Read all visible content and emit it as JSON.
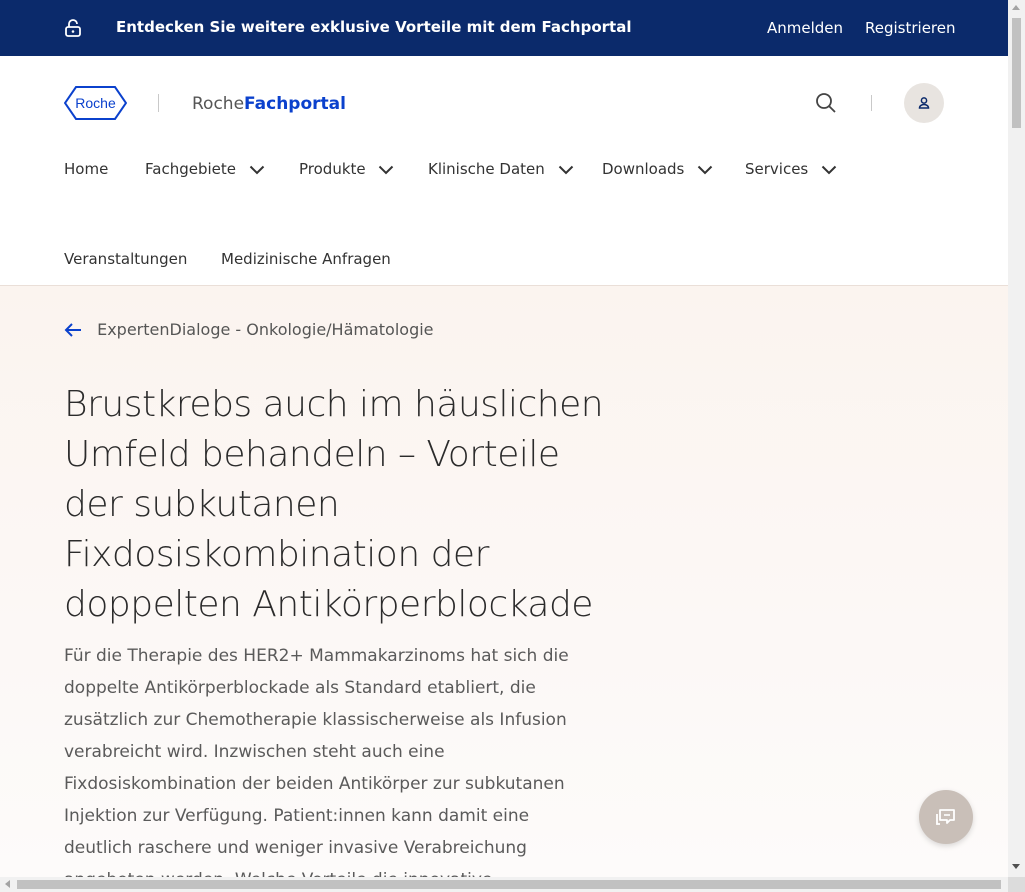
{
  "topbar": {
    "promo": "Entdecken Sie weitere exklusive Vorteile mit dem Fachportal",
    "login": "Anmelden",
    "register": "Registrieren",
    "icon": "lock-open-icon",
    "background": "#0b2a6b"
  },
  "header": {
    "logo_text": "Roche",
    "portal_prefix": "Roche",
    "portal_suffix": "Fachportal",
    "accent": "#0b41cd"
  },
  "nav": {
    "home": "Home",
    "fachgebiete": "Fachgebiete",
    "produkte": "Produkte",
    "klinische": "Klinische Daten",
    "downloads": "Downloads",
    "services": "Services",
    "veranstaltungen": "Veranstaltungen",
    "anfragen": "Medizinische Anfragen"
  },
  "hero": {
    "breadcrumb": "ExpertenDialoge - Onkologie/Hämatologie",
    "title": "Brustkrebs auch im häuslichen Umfeld behandeln – Vorteile der subkutanen Fixdosiskombination der doppelten Antikörperblockade",
    "intro": "Für die Therapie des HER2+ Mammakarzinoms hat sich die doppelte Antikörperblockade als Standard etabliert, die zusätzlich zur Chemotherapie klassischerweise als Infusion verabreicht wird. Inzwischen steht auch eine Fixdosiskombination der beiden Antikörper zur subkutanen Injektion zur Verfügung. Patient:innen kann damit eine deutlich raschere und weniger invasive Verabreichung angeboten werden. Welche Vorteile die innovative Darreichungsform im Vergleich zur Infusion für"
  }
}
